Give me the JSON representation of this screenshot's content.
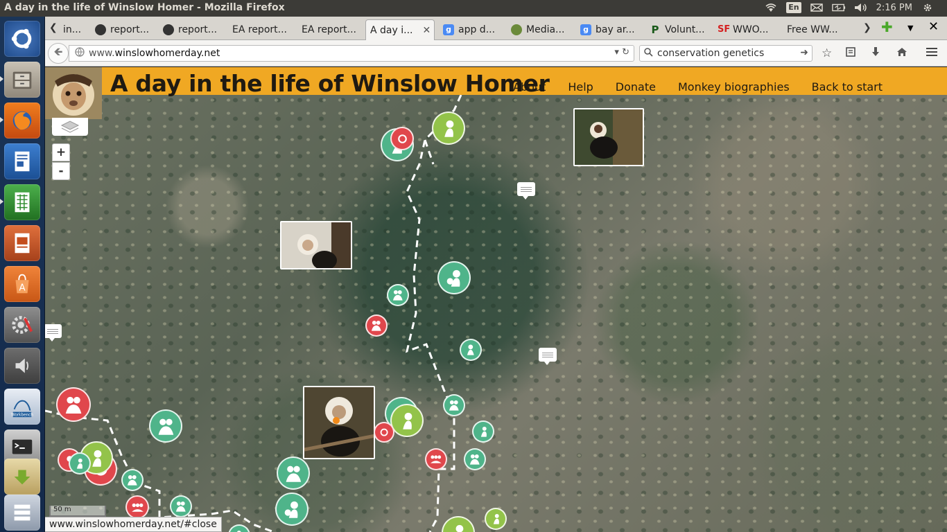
{
  "window": {
    "title": "A day in the life of Winslow Homer - Mozilla Firefox"
  },
  "indicators": {
    "language": "En",
    "time": "2:16 PM"
  },
  "launcher": [
    "ubuntu-dash",
    "files",
    "firefox",
    "writer",
    "calc",
    "impress",
    "software-center",
    "system-settings",
    "sound",
    "mysql-workbench",
    "terminal",
    "update-manager",
    "workspaces"
  ],
  "tabs": [
    {
      "label": "in...",
      "icon": "partial"
    },
    {
      "label": "report...",
      "icon": "github"
    },
    {
      "label": "report...",
      "icon": "github"
    },
    {
      "label": "EA report...",
      "icon": "none"
    },
    {
      "label": "EA report...",
      "icon": "none"
    },
    {
      "label": "A day i...",
      "icon": "none",
      "active": true
    },
    {
      "label": "app d...",
      "icon": "google"
    },
    {
      "label": "Media...",
      "icon": "media"
    },
    {
      "label": "bay ar...",
      "icon": "google"
    },
    {
      "label": "Volunt...",
      "icon": "p"
    },
    {
      "label": "WWO...",
      "icon": "sf"
    },
    {
      "label": "Free WW...",
      "icon": "none"
    }
  ],
  "address": {
    "prefix": "www.",
    "host": "winslowhomerday.net"
  },
  "search": {
    "value": "conservation genetics"
  },
  "site": {
    "title": "A day in the life of Winslow Homer",
    "nav": [
      "About",
      "Help",
      "Donate",
      "Monkey biographies",
      "Back to start"
    ]
  },
  "map": {
    "zoom_in": "+",
    "zoom_out": "-",
    "scale": "50 m"
  },
  "status_url": "www.winslowhomerday.net/#close",
  "colors": {
    "header": "#f0a823",
    "marker_green": "#4fb48a",
    "marker_lime": "#93c34a",
    "marker_red": "#e0474c"
  }
}
